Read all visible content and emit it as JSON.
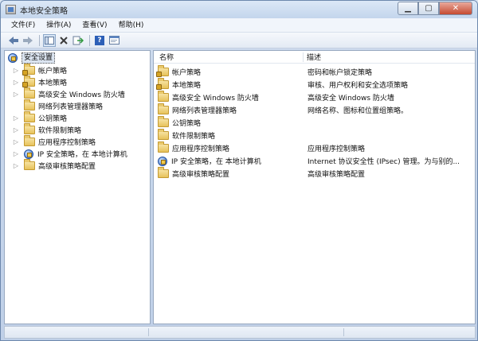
{
  "window": {
    "title": "本地安全策略",
    "caption": {
      "minimize": "▁",
      "maximize": "▢",
      "close": "✕"
    }
  },
  "menu": [
    "文件(F)",
    "操作(A)",
    "查看(V)",
    "帮助(H)"
  ],
  "toolbar": {
    "buttons": [
      "back-arrow-icon",
      "forward-arrow-icon",
      "show-hide-tree-icon",
      "delete-icon",
      "export-icon",
      "help-icon",
      "properties-icon"
    ],
    "help_label": "?"
  },
  "tree": {
    "root": "安全设置",
    "items": [
      {
        "label": "帐户策略",
        "icon": "folder-lock-icon"
      },
      {
        "label": "本地策略",
        "icon": "folder-lock-icon"
      },
      {
        "label": "高级安全 Windows 防火墙",
        "icon": "folder-icon"
      },
      {
        "label": "网络列表管理器策略",
        "icon": "folder-icon"
      },
      {
        "label": "公钥策略",
        "icon": "folder-icon"
      },
      {
        "label": "软件限制策略",
        "icon": "folder-icon"
      },
      {
        "label": "应用程序控制策略",
        "icon": "folder-icon"
      },
      {
        "label": "IP 安全策略，在 本地计算机",
        "icon": "ipsec-icon"
      },
      {
        "label": "高级审核策略配置",
        "icon": "folder-icon"
      }
    ]
  },
  "list": {
    "columns": {
      "name": "名称",
      "description": "描述"
    },
    "rows": [
      {
        "name": "帐户策略",
        "description": "密码和帐户锁定策略",
        "icon": "folder-lock-icon"
      },
      {
        "name": "本地策略",
        "description": "审核、用户权利和安全选项策略",
        "icon": "folder-lock-icon"
      },
      {
        "name": "高级安全 Windows 防火墙",
        "description": "高级安全 Windows 防火墙",
        "icon": "folder-icon"
      },
      {
        "name": "网络列表管理器策略",
        "description": "网络名称、图标和位置组策略。",
        "icon": "folder-icon"
      },
      {
        "name": "公钥策略",
        "description": "",
        "icon": "folder-icon"
      },
      {
        "name": "软件限制策略",
        "description": "",
        "icon": "folder-icon"
      },
      {
        "name": "应用程序控制策略",
        "description": "应用程序控制策略",
        "icon": "folder-icon"
      },
      {
        "name": "IP 安全策略，在 本地计算机",
        "description": "Internet 协议安全性 (IPsec) 管理。为与别的...",
        "icon": "ipsec-icon"
      },
      {
        "name": "高级审核策略配置",
        "description": "高级审核策略配置",
        "icon": "folder-icon"
      }
    ]
  }
}
